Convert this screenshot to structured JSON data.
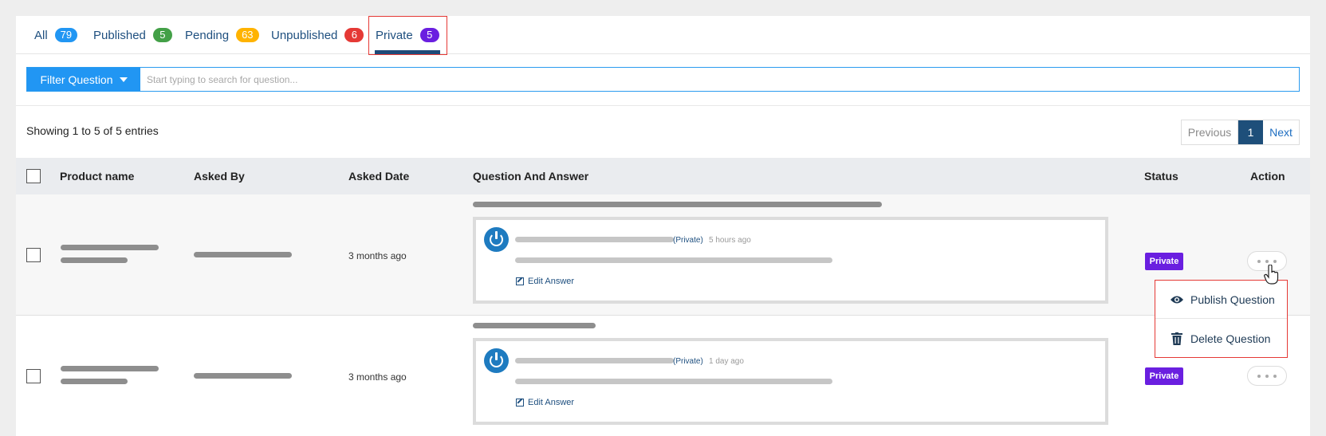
{
  "tabs": [
    {
      "label": "All",
      "count": "79",
      "color": "#2196f3"
    },
    {
      "label": "Published",
      "count": "5",
      "color": "#43a047"
    },
    {
      "label": "Pending",
      "count": "63",
      "color": "#ffb300"
    },
    {
      "label": "Unpublished",
      "count": "6",
      "color": "#e53935"
    },
    {
      "label": "Private",
      "count": "5",
      "color": "#6a1fe0"
    }
  ],
  "active_tab": "Private",
  "filter": {
    "button_label": "Filter Question",
    "search_placeholder": "Start typing to search for question..."
  },
  "table_info": {
    "showing": "Showing 1 to 5 of 5 entries"
  },
  "pagination": {
    "previous": "Previous",
    "current": "1",
    "next": "Next"
  },
  "columns": [
    "Product name",
    "Asked By",
    "Asked Date",
    "Question And Answer",
    "Status",
    "Action"
  ],
  "rows": [
    {
      "asked_date": "3 months ago",
      "answer_visibility": "(Private)",
      "answer_time": "5 hours ago",
      "edit_label": "Edit Answer",
      "status": "Private"
    },
    {
      "asked_date": "3 months ago",
      "answer_visibility": "(Private)",
      "answer_time": "1 day ago",
      "edit_label": "Edit Answer",
      "status": "Private"
    }
  ],
  "action_menu": {
    "publish": "Publish Question",
    "delete": "Delete Question"
  },
  "colors": {
    "accent": "#2196f3",
    "brand_dark": "#1e4f7a",
    "private": "#6a1fe0",
    "highlight": "#e53935"
  }
}
